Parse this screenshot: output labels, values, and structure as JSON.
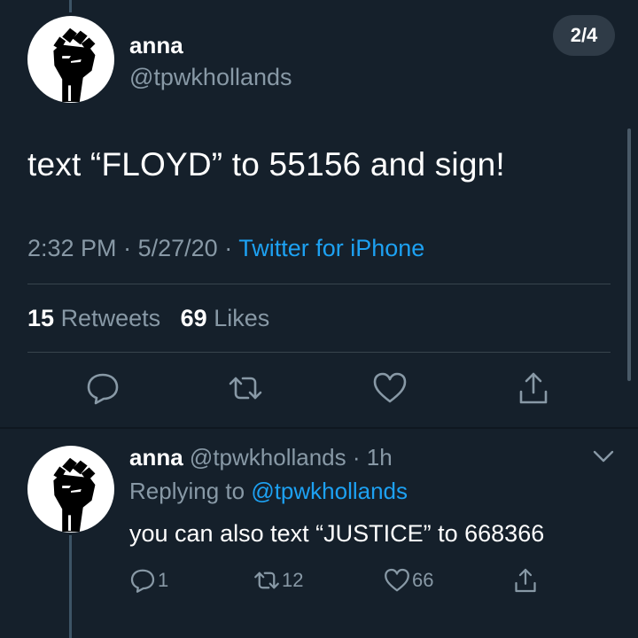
{
  "main_tweet": {
    "author_name": "anna",
    "author_handle": "@tpwkhollands",
    "page_indicator": "2/4",
    "text": "text “FLOYD” to 55156 and sign!",
    "time": "2:32 PM",
    "date": "5/27/20",
    "separator": "·",
    "source": "Twitter for iPhone",
    "retweets_count": "15",
    "retweets_label": "Retweets",
    "likes_count": "69",
    "likes_label": "Likes",
    "icons": [
      "reply-icon",
      "retweet-icon",
      "like-icon",
      "share-icon"
    ]
  },
  "reply_tweet": {
    "author_name": "anna",
    "author_handle": "@tpwkhollands",
    "separator": "·",
    "age": "1h",
    "replying_label": "Replying to",
    "replying_to": "@tpwkhollands",
    "text": "you can also text “JUSTICE” to 668366",
    "reply_count": "1",
    "retweet_count": "12",
    "like_count": "66"
  },
  "colors": {
    "background": "#15202b",
    "text_primary": "#ffffff",
    "text_secondary": "#8899a6",
    "accent": "#1da1f2",
    "divider": "#38444d"
  }
}
